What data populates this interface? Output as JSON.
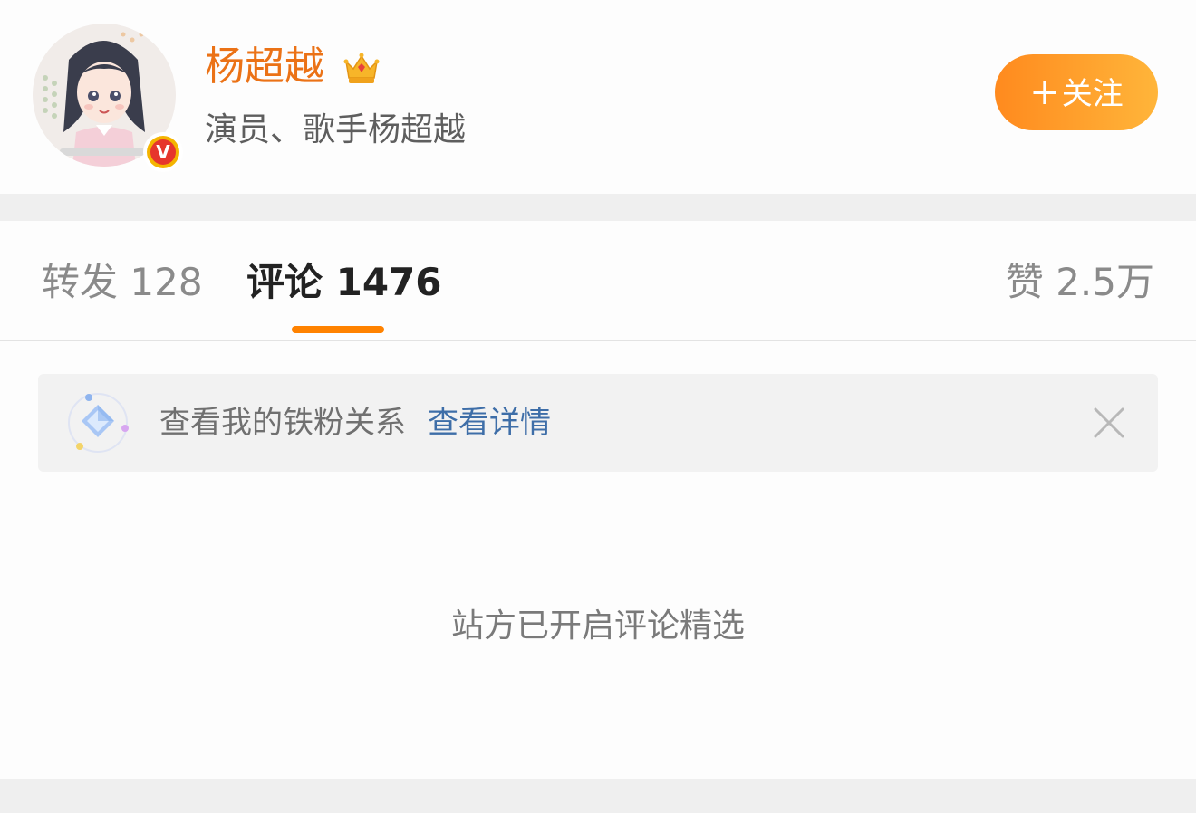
{
  "header": {
    "username": "杨超越",
    "bio": "演员、歌手杨超越",
    "follow_label": "关注",
    "follow_plus": "+",
    "verified_badge": "V",
    "crown_icon": "crown-icon",
    "avatar_icon": "avatar-illustration"
  },
  "tabs": [
    {
      "label": "转发",
      "count": "128"
    },
    {
      "label": "评论",
      "count": "1476"
    },
    {
      "label": "赞",
      "count": "2.5万"
    }
  ],
  "banner": {
    "text": "查看我的铁粉关系",
    "link": "查看详情",
    "icon": "diamond-fan-icon",
    "close_icon": "close-icon"
  },
  "notice": "站方已开启评论精选",
  "colors": {
    "accent": "#ff8200",
    "username": "#eb7216",
    "link": "#3e6ea8"
  }
}
